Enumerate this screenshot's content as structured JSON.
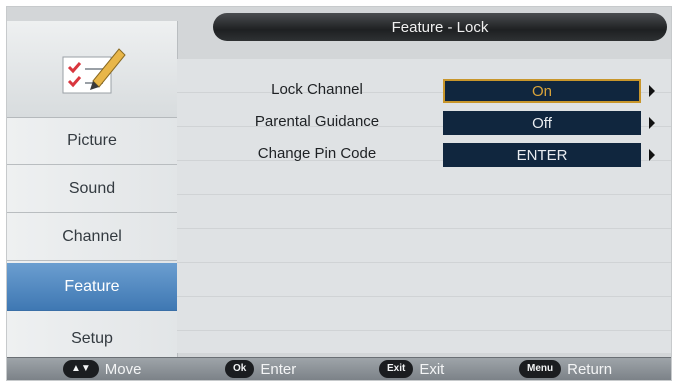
{
  "header": {
    "title": "Feature - Lock"
  },
  "sidebar": {
    "items": [
      {
        "label": "Picture"
      },
      {
        "label": "Sound"
      },
      {
        "label": "Channel"
      },
      {
        "label": "Feature"
      },
      {
        "label": "Setup"
      }
    ],
    "active": "Feature"
  },
  "settings": [
    {
      "label": "Lock Channel",
      "value": "On"
    },
    {
      "label": "Parental Guidance",
      "value": "Off"
    },
    {
      "label": "Change Pin Code",
      "value": "ENTER"
    }
  ],
  "footer": {
    "move": {
      "key": "▲▼",
      "label": "Move"
    },
    "enter": {
      "key": "Ok",
      "label": "Enter"
    },
    "exit": {
      "key": "Exit",
      "label": "Exit"
    },
    "menu": {
      "key": "Menu",
      "label": "Return"
    }
  },
  "colors": {
    "accent": "#4f86c0",
    "selection_border": "#c8962b",
    "value_bg": "#10263e"
  }
}
